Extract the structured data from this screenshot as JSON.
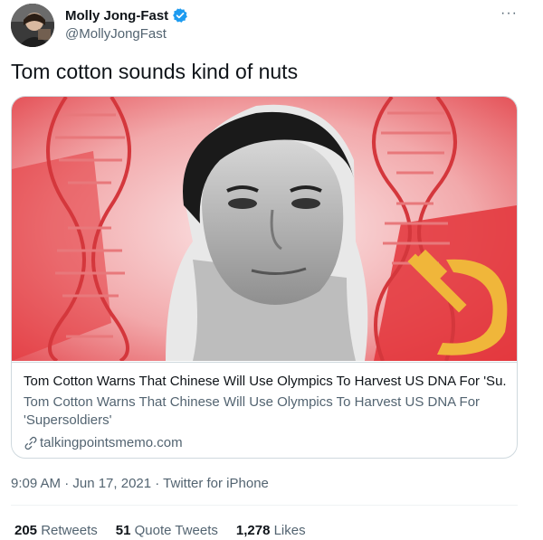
{
  "author": {
    "display_name": "Molly Jong-Fast",
    "handle": "@MollyJongFast",
    "avatar_icon": "profile-photo",
    "verified_icon": "verified-badge-icon",
    "verified_color": "#1d9bf0"
  },
  "more_label": "···",
  "tweet": {
    "text": "Tom cotton sounds kind of nuts"
  },
  "card": {
    "title": "Tom Cotton Warns That Chinese Will Use Olympics To Harvest US DNA For 'Su...",
    "description": "Tom Cotton Warns That Chinese Will Use Olympics To Harvest US DNA For 'Supersoldiers'",
    "domain": "talkingpointsmemo.com",
    "domain_icon": "link-icon"
  },
  "meta": {
    "timestamp": "9:09 AM · Jun 17, 2021 · Twitter for iPhone"
  },
  "stats": {
    "retweets": {
      "count": "205",
      "label": "Retweets"
    },
    "quote_tweets": {
      "count": "51",
      "label": "Quote Tweets"
    },
    "likes": {
      "count": "1,278",
      "label": "Likes"
    }
  },
  "colors": {
    "text": "#0f1419",
    "muted": "#536471",
    "border": "#cfd9de"
  }
}
